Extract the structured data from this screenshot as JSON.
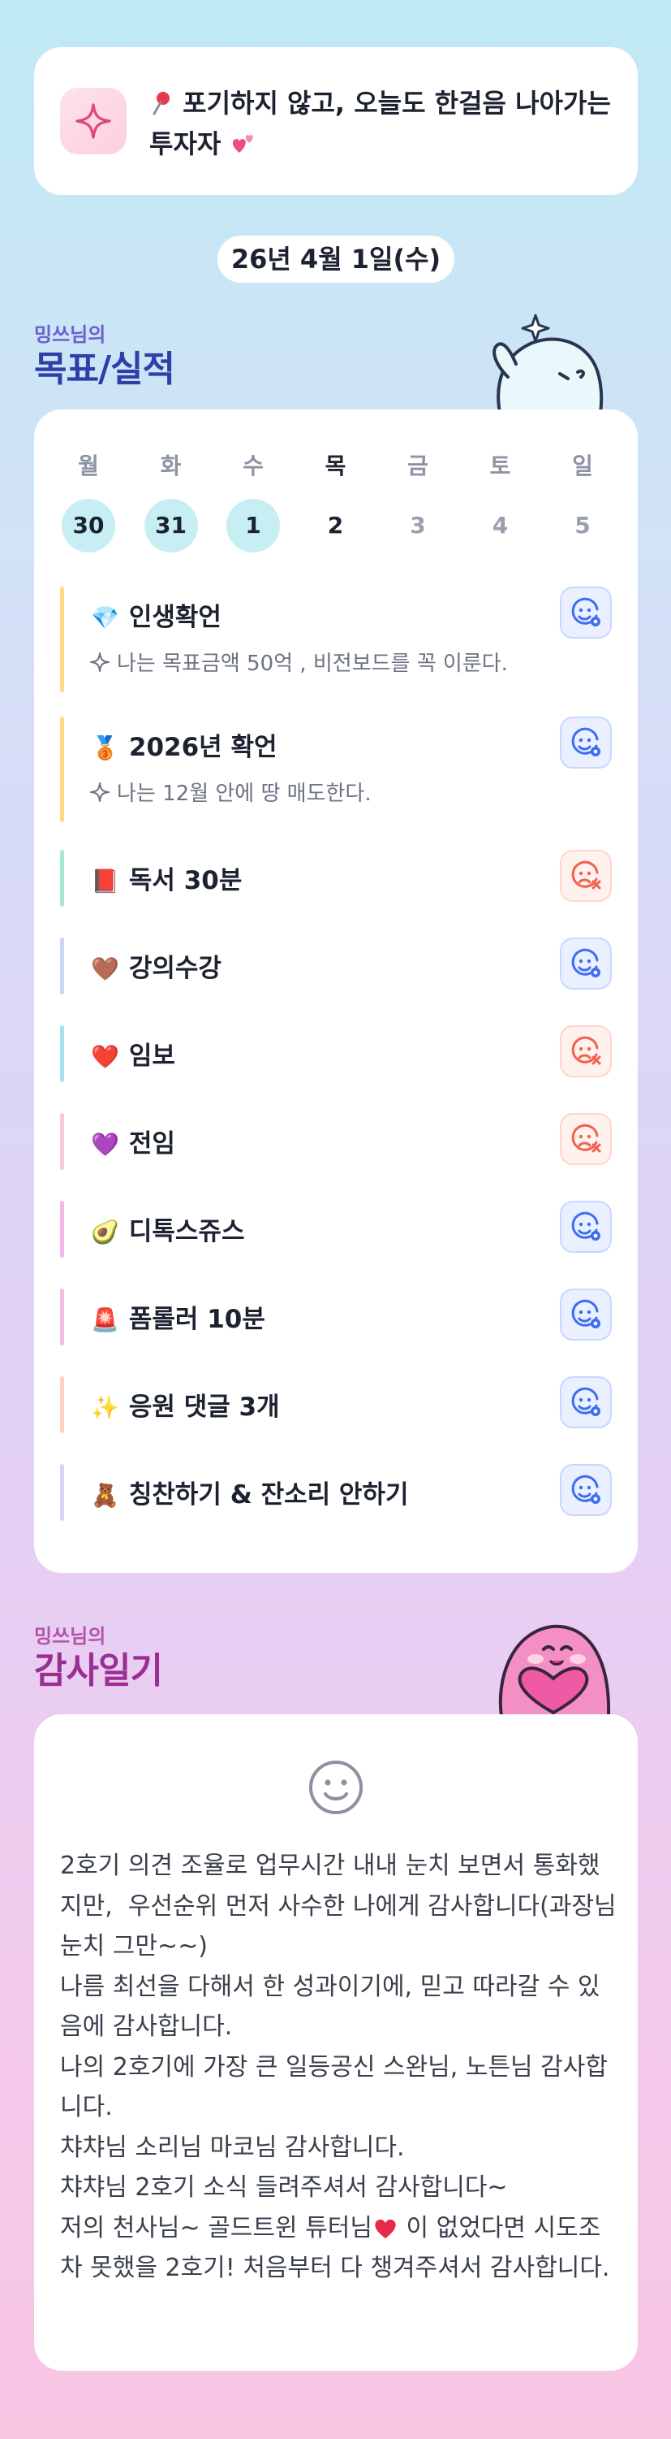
{
  "motto": {
    "pin_icon": "round-pushpin-icon",
    "text": "포기하지 않고, 오늘도 한걸음 나아가는 투자자",
    "end_emoji": "two-hearts-icon"
  },
  "date": "26년 4월 1일(수)",
  "goals_section": {
    "small": "밍쓰님의",
    "big": "목표/실적"
  },
  "week": [
    {
      "name": "월",
      "date": "30",
      "state": "done"
    },
    {
      "name": "화",
      "date": "31",
      "state": "done"
    },
    {
      "name": "수",
      "date": "1",
      "state": "done"
    },
    {
      "name": "목",
      "date": "2",
      "state": "today"
    },
    {
      "name": "금",
      "date": "3",
      "state": "future"
    },
    {
      "name": "토",
      "date": "4",
      "state": "future"
    },
    {
      "name": "일",
      "date": "5",
      "state": "future"
    }
  ],
  "goals": [
    {
      "emoji": "💎",
      "title": "인생확언",
      "sub": "나는 목표금액 50억 , 비전보드를 꼭 이룬다.",
      "status": "ok",
      "bar": "#ffd98a"
    },
    {
      "emoji": "🥉",
      "title": "2026년 확언",
      "sub": "나는 12월 안에 땅 매도한다.",
      "status": "ok",
      "bar": "#ffd98a"
    },
    {
      "emoji": "📕",
      "title": "독서 30분",
      "sub": "",
      "status": "fail",
      "bar": "#a8e6d9"
    },
    {
      "emoji": "🤎",
      "title": "강의수강",
      "sub": "",
      "status": "ok",
      "bar": "#c9d6f5"
    },
    {
      "emoji": "❤️",
      "title": "임보",
      "sub": "",
      "status": "fail",
      "bar": "#a9e1ef"
    },
    {
      "emoji": "💜",
      "title": "전임",
      "sub": "",
      "status": "fail",
      "bar": "#f7c8de"
    },
    {
      "emoji": "🥑",
      "title": "디톡스쥬스",
      "sub": "",
      "status": "ok",
      "bar": "#f2b8e6"
    },
    {
      "emoji": "🚨",
      "title": "폼롤러 10분",
      "sub": "",
      "status": "ok",
      "bar": "#f4bde3"
    },
    {
      "emoji": "✨",
      "title": "응원 댓글 3개",
      "sub": "",
      "status": "ok",
      "bar": "#ffd0c4"
    },
    {
      "emoji": "🧸",
      "title": "칭찬하기 & 잔소리 안하기",
      "sub": "",
      "status": "ok",
      "bar": "#d3d6f5"
    }
  ],
  "gratitude_section": {
    "small": "밍쓰님의",
    "big": "감사일기"
  },
  "gratitude": {
    "before_heart": "2호기 의견 조율로 업무시간 내내 눈치 보면서 통화했지만,  우선순위 먼저 사수한 나에게 감사합니다(과장님 눈치 그만~~)\n나름 최선을 다해서 한 성과이기에, 믿고 따라갈 수 있음에 감사합니다.\n나의 2호기에 가장 큰 일등공신 스완님, 노튼님 감사합니다.\n챠챠님 소리님 마코님 감사합니다.\n챠챠님 2호기 소식 들려주셔서 감사합니다~\n저의 천사님~ 골드트윈 튜터님",
    "heart_icon": "red-heart-icon",
    "after_heart": " 이 없었다면 시도조차 못했을 2호기! 처음부터 다 챙겨주셔서 감사합니다."
  },
  "colors": {
    "ok_status": "#3d6df2",
    "fail_status": "#f0624d",
    "done_day": "#c6eef3",
    "goal_heading": "#2f3fa8",
    "grat_heading": "#9c2e92"
  }
}
